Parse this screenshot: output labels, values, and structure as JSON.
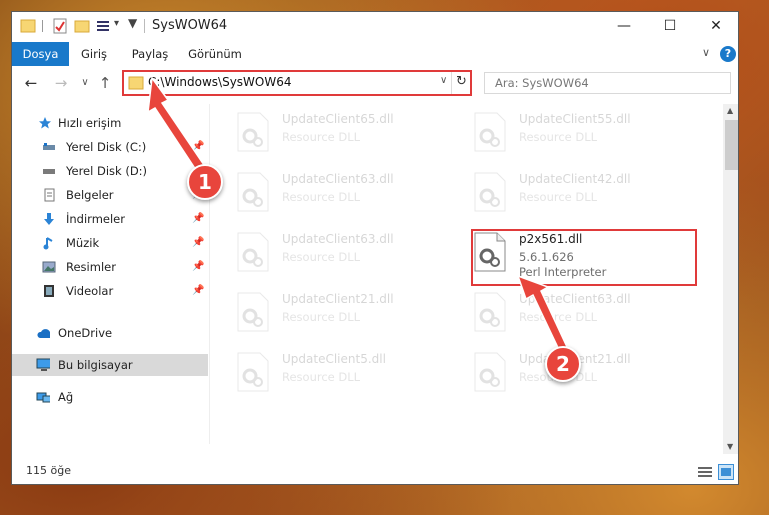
{
  "window": {
    "title": "SysWOW64"
  },
  "titlebar_buttons": {
    "minimize": "—",
    "maximize": "☐",
    "close": "✕"
  },
  "ribbon": {
    "tabs": [
      "Dosya",
      "Giriş",
      "Paylaş",
      "Görünüm"
    ],
    "active_tab": "Dosya",
    "expand": "∨",
    "help": "?"
  },
  "address": {
    "path": "C:\\Windows\\SysWOW64",
    "refresh": "↻",
    "dropdown": "∨"
  },
  "search": {
    "placeholder": "Ara: SysWOW64"
  },
  "nav": {
    "back": "←",
    "forward": "→",
    "recent": "∨",
    "up": "↑"
  },
  "sidebar": {
    "items": [
      {
        "label": "Hızlı erişim",
        "icon": "star-icon"
      },
      {
        "label": "Yerel Disk (C:)",
        "icon": "drive-icon",
        "pinned": true
      },
      {
        "label": "Yerel Disk (D:)",
        "icon": "drive-icon"
      },
      {
        "label": "Belgeler",
        "icon": "documents-icon",
        "pinned": true
      },
      {
        "label": "İndirmeler",
        "icon": "download-icon",
        "pinned": true
      },
      {
        "label": "Müzik",
        "icon": "music-icon",
        "pinned": true
      },
      {
        "label": "Resimler",
        "icon": "pictures-icon",
        "pinned": true
      },
      {
        "label": "Videolar",
        "icon": "videos-icon",
        "pinned": true
      },
      {
        "label": "OneDrive",
        "icon": "cloud-icon"
      },
      {
        "label": "Bu bilgisayar",
        "icon": "computer-icon",
        "selected": true
      },
      {
        "label": "Ağ",
        "icon": "network-icon"
      }
    ]
  },
  "files": [
    {
      "name": "UpdateClient65.dll",
      "desc": "Resource DLL",
      "faded": true
    },
    {
      "name": "UpdateClient55.dll",
      "desc": "Resource DLL",
      "faded": true
    },
    {
      "name": "UpdateClient63.dll",
      "desc": "Resource DLL",
      "faded": true
    },
    {
      "name": "UpdateClient42.dll",
      "desc": "Resource DLL",
      "faded": true
    },
    {
      "name": "UpdateClient63.dll",
      "desc": "Resource DLL",
      "faded": true
    },
    {
      "name": "p2x561.dll",
      "version": "5.6.1.626",
      "desc": "Perl Interpreter",
      "faded": false
    },
    {
      "name": "UpdateClient21.dll",
      "desc": "Resource DLL",
      "faded": true
    },
    {
      "name": "UpdateClient63.dll",
      "desc": "Resource DLL",
      "faded": true
    },
    {
      "name": "UpdateClient5.dll",
      "desc": "Resource DLL",
      "faded": true
    },
    {
      "name": "UpdateClient21.dll",
      "desc": "Resource DLL",
      "faded": true
    }
  ],
  "status": {
    "count": "115 öğe"
  },
  "annotations": {
    "badge1": "1",
    "badge2": "2",
    "color": "#e8453c"
  }
}
